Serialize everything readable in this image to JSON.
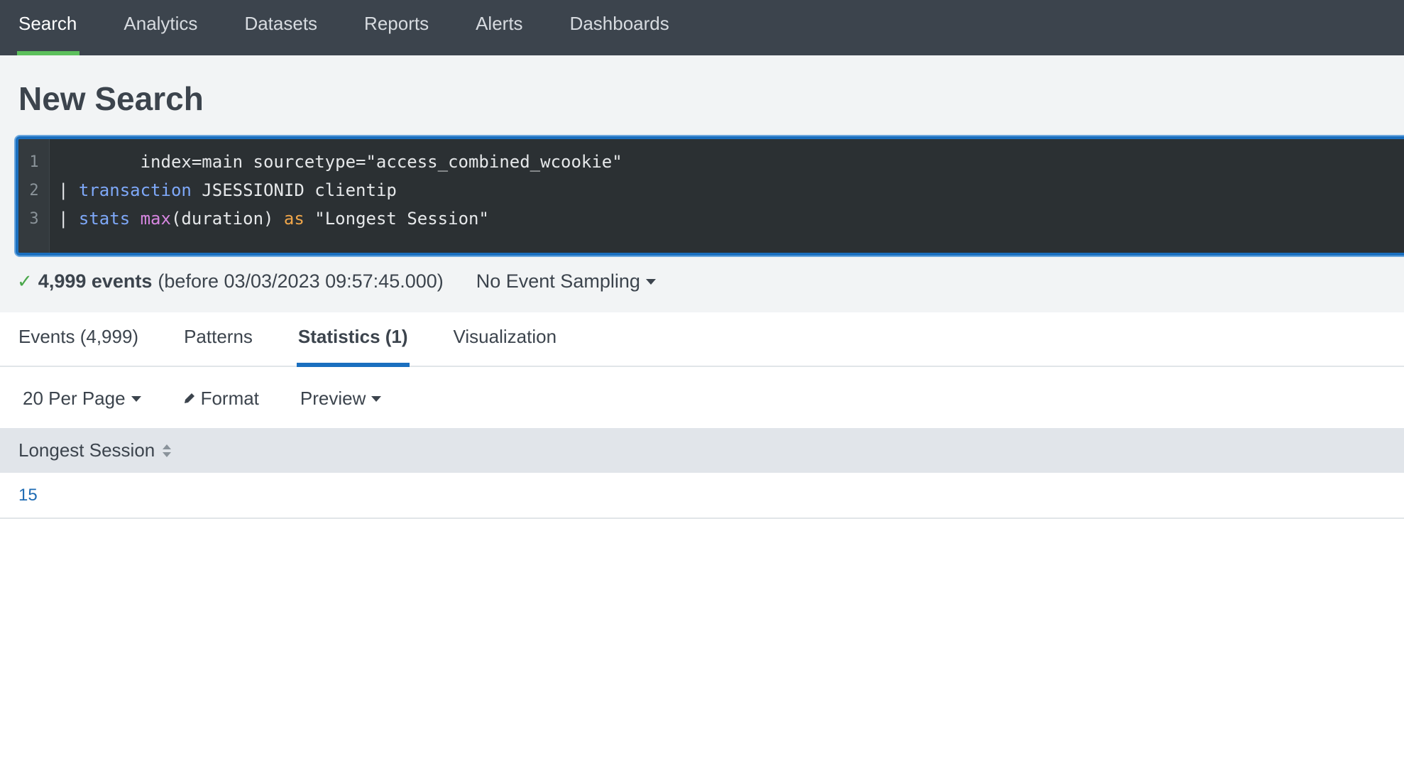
{
  "nav": {
    "items": [
      {
        "label": "Search",
        "active": true
      },
      {
        "label": "Analytics"
      },
      {
        "label": "Datasets"
      },
      {
        "label": "Reports"
      },
      {
        "label": "Alerts"
      },
      {
        "label": "Dashboards"
      }
    ]
  },
  "page": {
    "title": "New Search"
  },
  "editor": {
    "lines": [
      {
        "num": "1",
        "tokens": [
          {
            "text": "index=main sourcetype=\"access_combined_wcookie\"",
            "kind": "txt"
          }
        ]
      },
      {
        "num": "2",
        "tokens": [
          {
            "text": "| ",
            "kind": "txt"
          },
          {
            "text": "transaction",
            "kind": "cmd"
          },
          {
            "text": " JSESSIONID clientip",
            "kind": "txt"
          }
        ]
      },
      {
        "num": "3",
        "tokens": [
          {
            "text": "| ",
            "kind": "txt"
          },
          {
            "text": "stats",
            "kind": "cmd"
          },
          {
            "text": " ",
            "kind": "txt"
          },
          {
            "text": "max",
            "kind": "fn"
          },
          {
            "text": "(duration) ",
            "kind": "txt"
          },
          {
            "text": "as",
            "kind": "kw"
          },
          {
            "text": " \"Longest Session\"",
            "kind": "txt"
          }
        ]
      }
    ]
  },
  "status": {
    "check": "✓",
    "count": "4,999 events",
    "range": "(before 03/03/2023 09:57:45.000)",
    "sampling": "No Event Sampling"
  },
  "tabs": [
    {
      "label": "Events (4,999)"
    },
    {
      "label": "Patterns"
    },
    {
      "label": "Statistics (1)",
      "active": true
    },
    {
      "label": "Visualization"
    }
  ],
  "toolbar": {
    "per_page": "20 Per Page",
    "format": "Format",
    "preview": "Preview"
  },
  "table": {
    "header": "Longest Session",
    "rows": [
      "15"
    ]
  },
  "colors": {
    "nav_bg": "#3c444d",
    "nav_active_underline": "#5cc05c",
    "tab_active_underline": "#1a6fbf",
    "editor_bg": "#2b3033",
    "link": "#1e6bb3"
  },
  "icons": {
    "status_check": "check-icon",
    "sampling_caret": "caret-down-icon",
    "format": "pencil-icon",
    "sort": "sort-icon"
  }
}
